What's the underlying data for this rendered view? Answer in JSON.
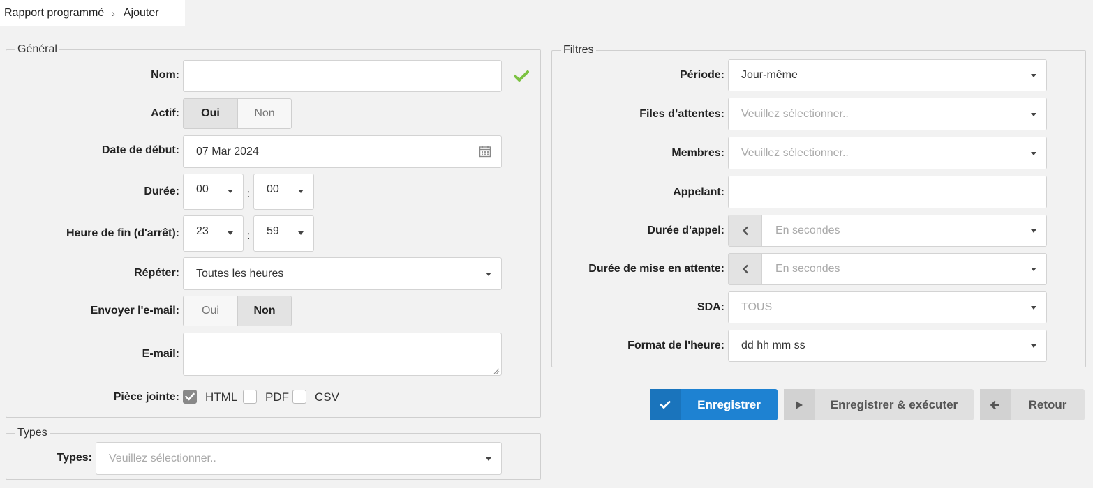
{
  "breadcrumb": {
    "parent": "Rapport programmé",
    "separator": "›",
    "current": "Ajouter"
  },
  "general": {
    "legend": "Général",
    "nom_label": "Nom:",
    "nom_value": "",
    "actif_label": "Actif:",
    "actif_options": [
      "Oui",
      "Non"
    ],
    "actif_selected": "Oui",
    "date_label": "Date de début:",
    "date_value": "07 Mar 2024",
    "duree_label": "Durée:",
    "duree_hours": "00",
    "duree_minutes": "00",
    "fin_label": "Heure de fin (d'arrêt):",
    "fin_hours": "23",
    "fin_minutes": "59",
    "colon": ":",
    "repeter_label": "Répéter:",
    "repeter_value": "Toutes les heures",
    "envoyer_label": "Envoyer l'e-mail:",
    "envoyer_options": [
      "Oui",
      "Non"
    ],
    "envoyer_selected": "Non",
    "email_label": "E-mail:",
    "email_value": "",
    "piece_label": "Pièce jointe:",
    "attachments": [
      {
        "label": "HTML",
        "checked": true
      },
      {
        "label": "PDF",
        "checked": false
      },
      {
        "label": "CSV",
        "checked": false
      }
    ]
  },
  "types": {
    "legend": "Types",
    "label": "Types:",
    "placeholder": "Veuillez sélectionner.."
  },
  "filtres": {
    "legend": "Filtres",
    "periode_label": "Période:",
    "periode_value": "Jour-même",
    "files_label": "Files d’attentes:",
    "files_placeholder": "Veuillez sélectionner..",
    "membres_label": "Membres:",
    "membres_placeholder": "Veuillez sélectionner..",
    "appelant_label": "Appelant:",
    "appelant_value": "",
    "duree_appel_label": "Durée d'appel:",
    "duree_appel_placeholder": "En secondes",
    "duree_attente_label": "Durée de mise en attente:",
    "duree_attente_placeholder": "En secondes",
    "sda_label": "SDA:",
    "sda_value": "TOUS",
    "format_label": "Format de l'heure:",
    "format_value": "dd hh mm ss"
  },
  "buttons": {
    "save": "Enregistrer",
    "save_run": "Enregistrer & exécuter",
    "back": "Retour"
  },
  "colors": {
    "primary": "#1e82d2",
    "valid_check": "#7cc242"
  },
  "icons": [
    "check-icon",
    "calendar-icon",
    "chevron-left-icon",
    "play-icon",
    "arrow-left-icon"
  ]
}
